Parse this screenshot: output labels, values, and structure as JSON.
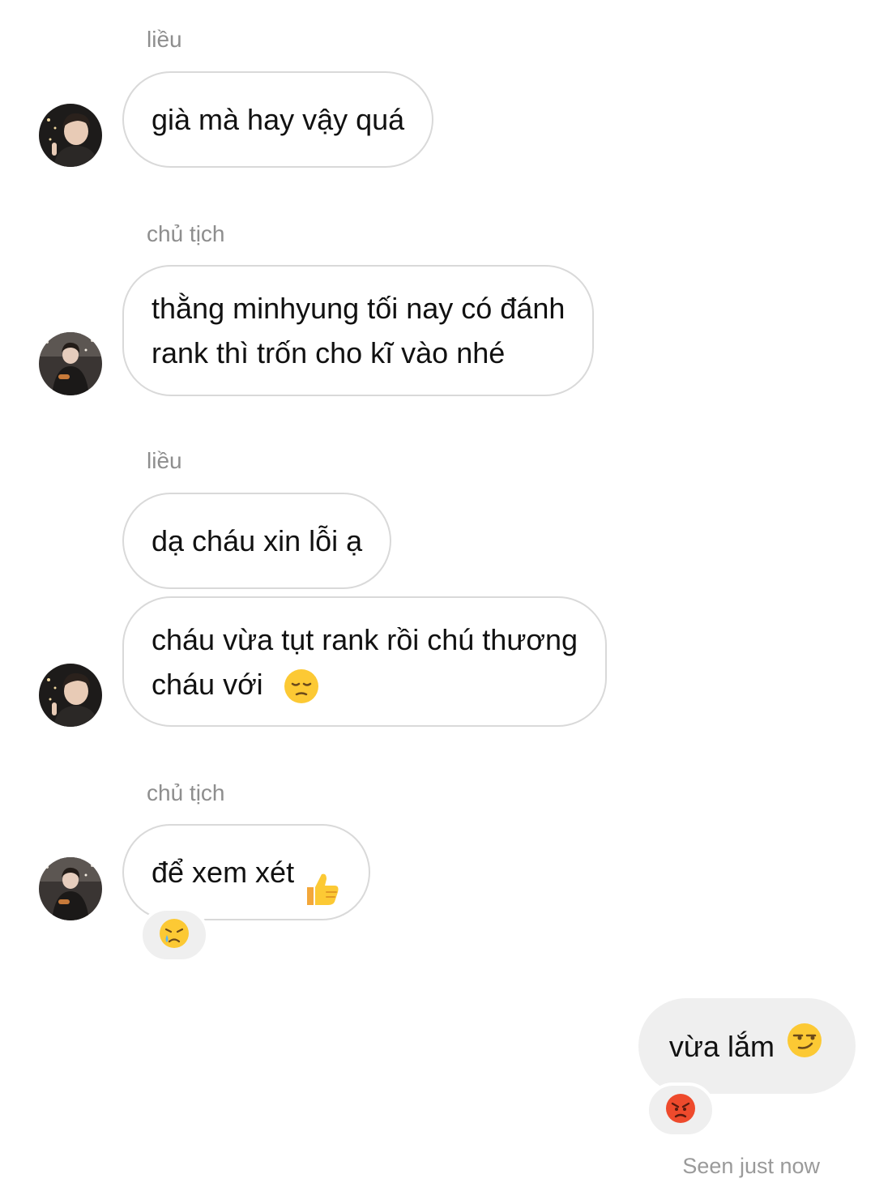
{
  "messages": [
    {
      "sender": "liều",
      "texts": [
        "già mà hay vậy quá"
      ]
    },
    {
      "sender": "chủ tịch",
      "texts": [
        "thằng minhyung tối nay có đánh\nrank thì trốn cho kĩ vào nhé"
      ]
    },
    {
      "sender": "liều",
      "texts": [
        "dạ cháu xin lỗi ạ",
        "cháu vừa tụt rank rồi chú thương\ncháu với"
      ],
      "inline_emoji": "pensive-face-icon"
    },
    {
      "sender": "chủ tịch",
      "texts": [
        "để xem xét"
      ],
      "inline_emoji": "thumbs-up-icon",
      "reaction": "crying-face-icon"
    }
  ],
  "outgoing": {
    "text": "vừa lắm",
    "inline_emoji": "smirking-face-icon",
    "reaction": "angry-face-icon"
  },
  "seen_status": "Seen just now",
  "colors": {
    "incoming_border": "#d9d9d9",
    "outgoing_bg": "#efefef",
    "meta_text": "#8e8e8e"
  }
}
